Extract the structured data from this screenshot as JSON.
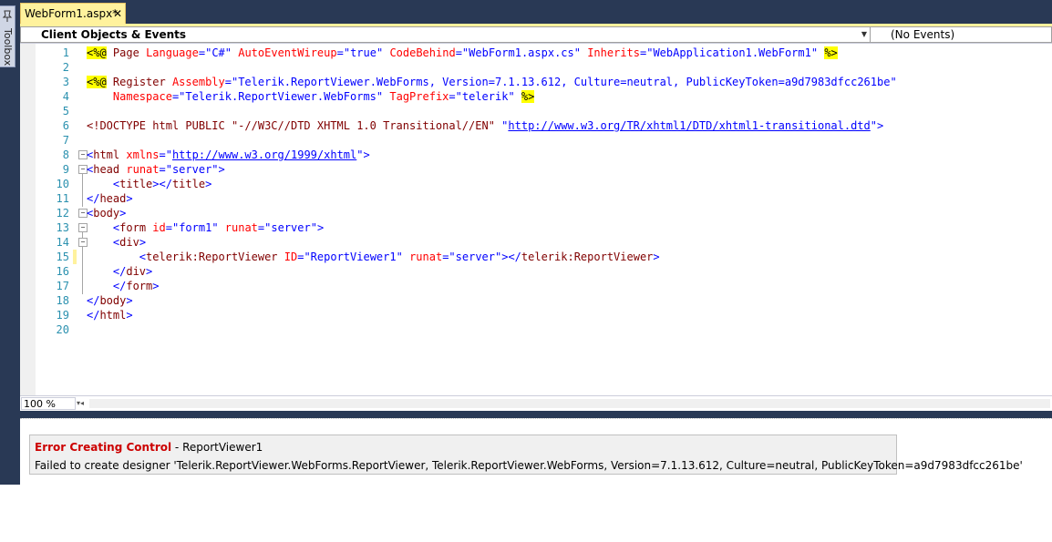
{
  "toolbox": {
    "label": "Toolbox"
  },
  "tab": {
    "title": "WebForm1.aspx*",
    "close_glyph": "✕"
  },
  "navbar": {
    "objects": "Client Objects & Events",
    "events": "(No Events)"
  },
  "zoom": "100 %",
  "code_lines": [
    {
      "n": "1",
      "hl": true
    },
    {
      "n": "2"
    },
    {
      "n": "3",
      "hl": true
    },
    {
      "n": "4"
    },
    {
      "n": "5"
    },
    {
      "n": "6"
    },
    {
      "n": "7"
    },
    {
      "n": "8"
    },
    {
      "n": "9"
    },
    {
      "n": "10"
    },
    {
      "n": "11"
    },
    {
      "n": "12"
    },
    {
      "n": "13"
    },
    {
      "n": "14"
    },
    {
      "n": "15",
      "changed": true
    },
    {
      "n": "16"
    },
    {
      "n": "17"
    },
    {
      "n": "18"
    },
    {
      "n": "19"
    },
    {
      "n": "20"
    }
  ],
  "code": {
    "l1": {
      "open": "<%@",
      "kw": "Page",
      "a1": "Language",
      "v1": "\"C#\"",
      "a2": "AutoEventWireup",
      "v2": "\"true\"",
      "a3": "CodeBehind",
      "v3": "\"WebForm1.aspx.cs\"",
      "a4": "Inherits",
      "v4": "\"WebApplication1.WebForm1\"",
      "close": "%>"
    },
    "l3": {
      "open": "<%@",
      "kw": "Register",
      "a1": "Assembly",
      "v1": "\"Telerik.ReportViewer.WebForms, Version=7.1.13.612, Culture=neutral, PublicKeyToken=a9d7983dfcc261be\""
    },
    "l4": {
      "a1": "Namespace",
      "v1": "\"Telerik.ReportViewer.WebForms\"",
      "a2": "TagPrefix",
      "v2": "\"telerik\"",
      "close": "%>"
    },
    "l6": {
      "text": "<!DOCTYPE html PUBLIC \"-//W3C//DTD XHTML 1.0 Transitional//EN\"",
      "link": "http://www.w3.org/TR/xhtml1/DTD/xhtml1-transitional.dtd",
      "q": "\""
    },
    "l8": {
      "el": "html",
      "a1": "xmlns",
      "link": "http://www.w3.org/1999/xhtml"
    },
    "l9": {
      "el": "head",
      "a1": "runat",
      "v1": "\"server\""
    },
    "l10": {
      "el": "title"
    },
    "l11": {
      "el": "head"
    },
    "l12": {
      "el": "body"
    },
    "l13": {
      "el": "form",
      "a1": "id",
      "v1": "\"form1\"",
      "a2": "runat",
      "v2": "\"server\""
    },
    "l14": {
      "el": "div"
    },
    "l15": {
      "el": "telerik:ReportViewer",
      "a1": "ID",
      "v1": "\"ReportViewer1\"",
      "a2": "runat",
      "v2": "\"server\""
    },
    "l16": {
      "el": "div"
    },
    "l17": {
      "el": "form"
    },
    "l18": {
      "el": "body"
    },
    "l19": {
      "el": "html"
    }
  },
  "error": {
    "title": "Error Creating Control",
    "control": " - ReportViewer1",
    "message": "Failed to create designer 'Telerik.ReportViewer.WebForms.ReportViewer, Telerik.ReportViewer.WebForms, Version=7.1.13.612, Culture=neutral, PublicKeyToken=a9d7983dfcc261be'"
  }
}
